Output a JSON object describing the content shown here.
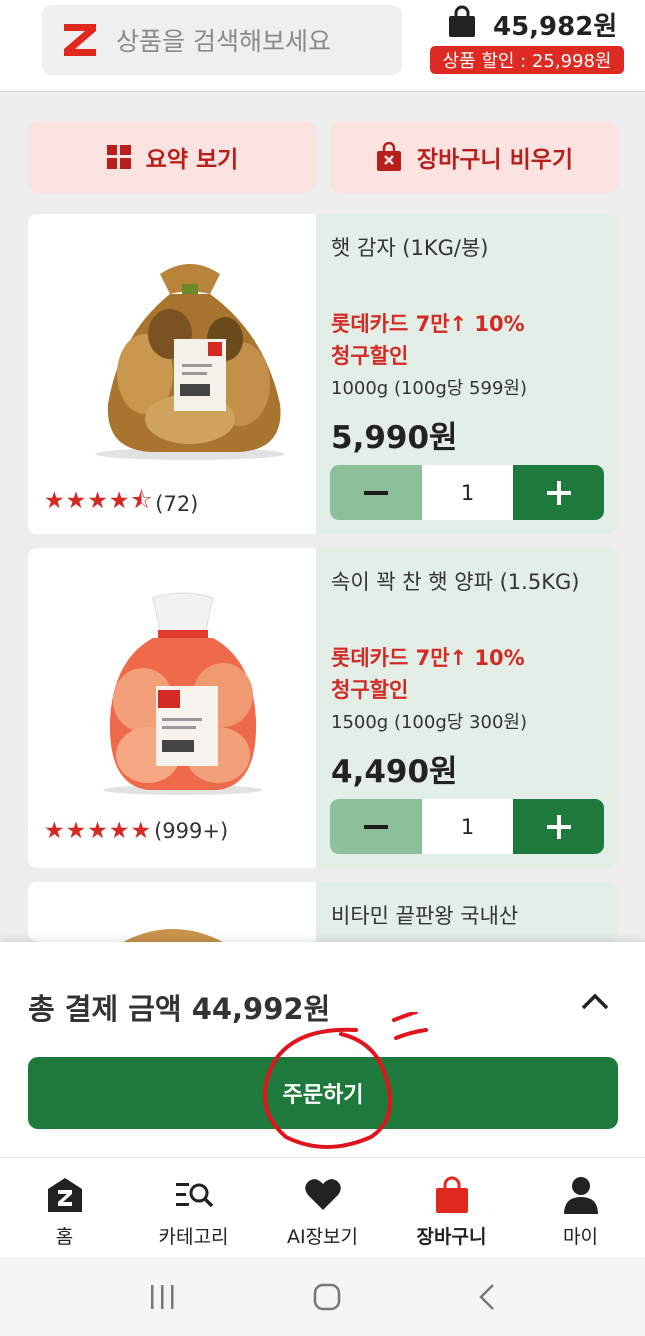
{
  "header": {
    "search_placeholder": "상품을 검색해보세요",
    "cart_total": "45,982원",
    "discount_badge": "상품 할인 : 25,998원"
  },
  "actions": {
    "summary_label": "요약 보기",
    "empty_cart_label": "장바구니 비우기"
  },
  "products": [
    {
      "name": "햇 감자 (1KG/봉)",
      "promo_line1": "롯데카드 7만↑ 10%",
      "promo_line2": "청구할인",
      "unit": "1000g (100g당 599원)",
      "price": "5,990원",
      "quantity": "1",
      "stars": "★★★★⯪",
      "rating": 4.5,
      "review_count": "(72)"
    },
    {
      "name": "속이 꽉 찬 햇  양파 (1.5KG)",
      "promo_line1": "롯데카드 7만↑ 10%",
      "promo_line2": "청구할인",
      "unit": "1500g (100g당 300원)",
      "price": "4,490원",
      "quantity": "1",
      "stars": "★★★★★",
      "rating": 5,
      "review_count": "(999+)"
    },
    {
      "name": "비타민 끝판왕  국내산"
    }
  ],
  "checkout": {
    "total_label": "총 결제 금액 44,992원",
    "order_button": "주문하기"
  },
  "nav": {
    "items": [
      {
        "label": "홈",
        "icon": "home-icon"
      },
      {
        "label": "카테고리",
        "icon": "category-search-icon"
      },
      {
        "label": "AI장보기",
        "icon": "heart-icon"
      },
      {
        "label": "장바구니",
        "icon": "shopping-bag-icon",
        "active": true
      },
      {
        "label": "마이",
        "icon": "person-icon"
      }
    ]
  },
  "colors": {
    "brand_red": "#d32a24",
    "brand_green": "#1e7a3c",
    "light_green": "#e3eee6",
    "light_pink": "#fbe3e1"
  }
}
